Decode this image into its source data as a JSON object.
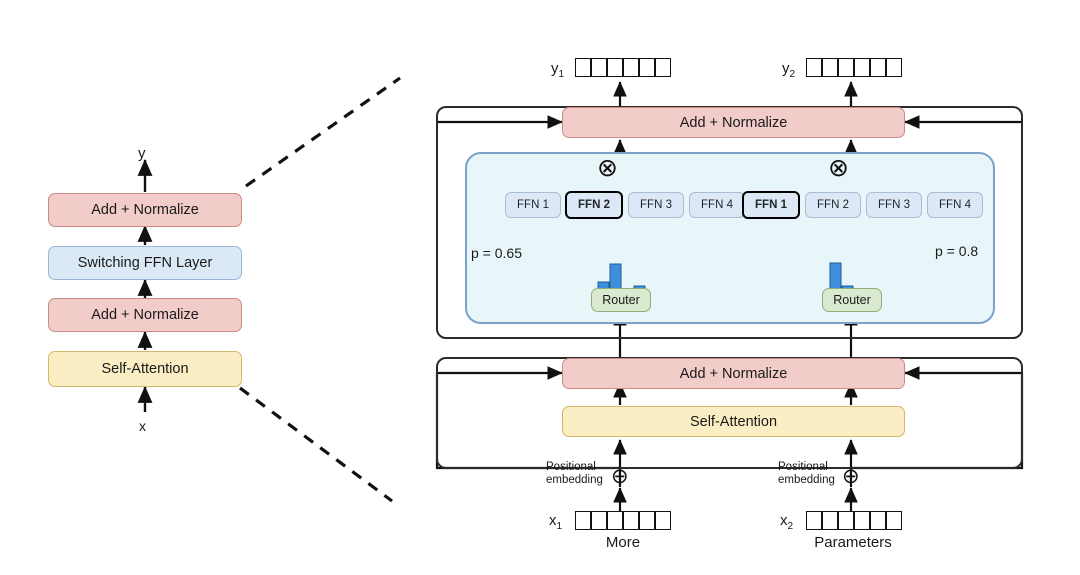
{
  "figure": {
    "title": "Switch Transformer encoder block diagram",
    "left_panel": {
      "output_label": "y",
      "input_label": "x",
      "blocks": [
        {
          "id": "add-norm-top",
          "label": "Add + Normalize",
          "color": "#f2ccc8"
        },
        {
          "id": "switching-ffn",
          "label": "Switching FFN Layer",
          "color": "#dbe9f7"
        },
        {
          "id": "add-norm-bottom",
          "label": "Add + Normalize",
          "color": "#f2ccc8"
        },
        {
          "id": "self-attention",
          "label": "Self-Attention",
          "color": "#fbeec4"
        }
      ]
    },
    "right_panel": {
      "top_add_norm": "Add + Normalize",
      "bottom_add_norm": "Add + Normalize",
      "self_attention": "Self-Attention",
      "outputs": [
        {
          "name": "y",
          "sub": "1",
          "cells": 6
        },
        {
          "name": "y",
          "sub": "2",
          "cells": 6
        }
      ],
      "inputs": [
        {
          "name": "x",
          "sub": "1",
          "cells": 6,
          "word": "More",
          "pos_embedding": [
            "Positional",
            "embedding"
          ]
        },
        {
          "name": "x",
          "sub": "2",
          "cells": 6,
          "word": "Parameters",
          "pos_embedding": [
            "Positional",
            "embedding"
          ]
        }
      ],
      "experts": [
        {
          "router_label": "Router",
          "p_label": "p = 0.65",
          "ffns": [
            {
              "label": "FFN 1",
              "selected": false
            },
            {
              "label": "FFN 2",
              "selected": true
            },
            {
              "label": "FFN 3",
              "selected": false
            },
            {
              "label": "FFN 4",
              "selected": false
            }
          ],
          "multiply_symbol": "⊗",
          "histogram": [
            0.55,
            1.0,
            0.25,
            0.45
          ]
        },
        {
          "router_label": "Router",
          "p_label": "p = 0.8",
          "ffns": [
            {
              "label": "FFN 1",
              "selected": true
            },
            {
              "label": "FFN 2",
              "selected": false
            },
            {
              "label": "FFN 3",
              "selected": false
            },
            {
              "label": "FFN 4",
              "selected": false
            }
          ],
          "multiply_symbol": "⊗",
          "histogram": [
            1.0,
            0.46,
            0.24,
            0.08
          ]
        }
      ],
      "plus_symbol": "⊕"
    },
    "colors": {
      "pink": "#f2ccc8",
      "pink_border": "#c98b86",
      "yellow": "#fbeec4",
      "yellow_border": "#d4b768",
      "blue": "#dbe9f7",
      "blue_border": "#9bb7d4",
      "green": "#d9ead0",
      "green_border": "#8fae79",
      "moe_fill": "#e9f6f9",
      "moe_border": "#7ba2c8",
      "histogram_bar": "#3f8fdc",
      "line": "#111111"
    }
  }
}
